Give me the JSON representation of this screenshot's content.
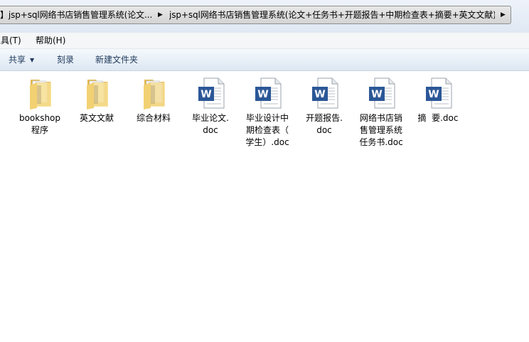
{
  "breadcrumb": {
    "segment1": "】jsp+sql网络书店销售管理系统(论文...",
    "segment2": "jsp+sql网络书店销售管理系统(论文+任务书+开题报告+中期检查表+摘要+英文文献)"
  },
  "menu": {
    "tools": "工具(T)",
    "help": "帮助(H)"
  },
  "commands": {
    "share": "共享",
    "burn": "刻录",
    "new_folder": "新建文件夹"
  },
  "files": [
    {
      "type": "folder",
      "line1": "bookshop",
      "line2": "程序",
      "line3": ""
    },
    {
      "type": "folder",
      "line1": "英文文献",
      "line2": "",
      "line3": ""
    },
    {
      "type": "folder",
      "line1": "综合材料",
      "line2": "",
      "line3": ""
    },
    {
      "type": "doc",
      "line1": "毕业论文.",
      "line2": "doc",
      "line3": ""
    },
    {
      "type": "doc",
      "line1": "毕业设计中",
      "line2": "期检查表（",
      "line3": "学生）.doc"
    },
    {
      "type": "doc",
      "line1": "开题报告.",
      "line2": "doc",
      "line3": ""
    },
    {
      "type": "doc",
      "line1": "网络书店销",
      "line2": "售管理系统",
      "line3": "任务书.doc"
    },
    {
      "type": "doc",
      "line1": "摘  要.doc",
      "line2": "",
      "line3": ""
    }
  ],
  "colors": {
    "folder": "#f2d173",
    "word_blue": "#2b5797",
    "command_text": "#1e395b"
  }
}
